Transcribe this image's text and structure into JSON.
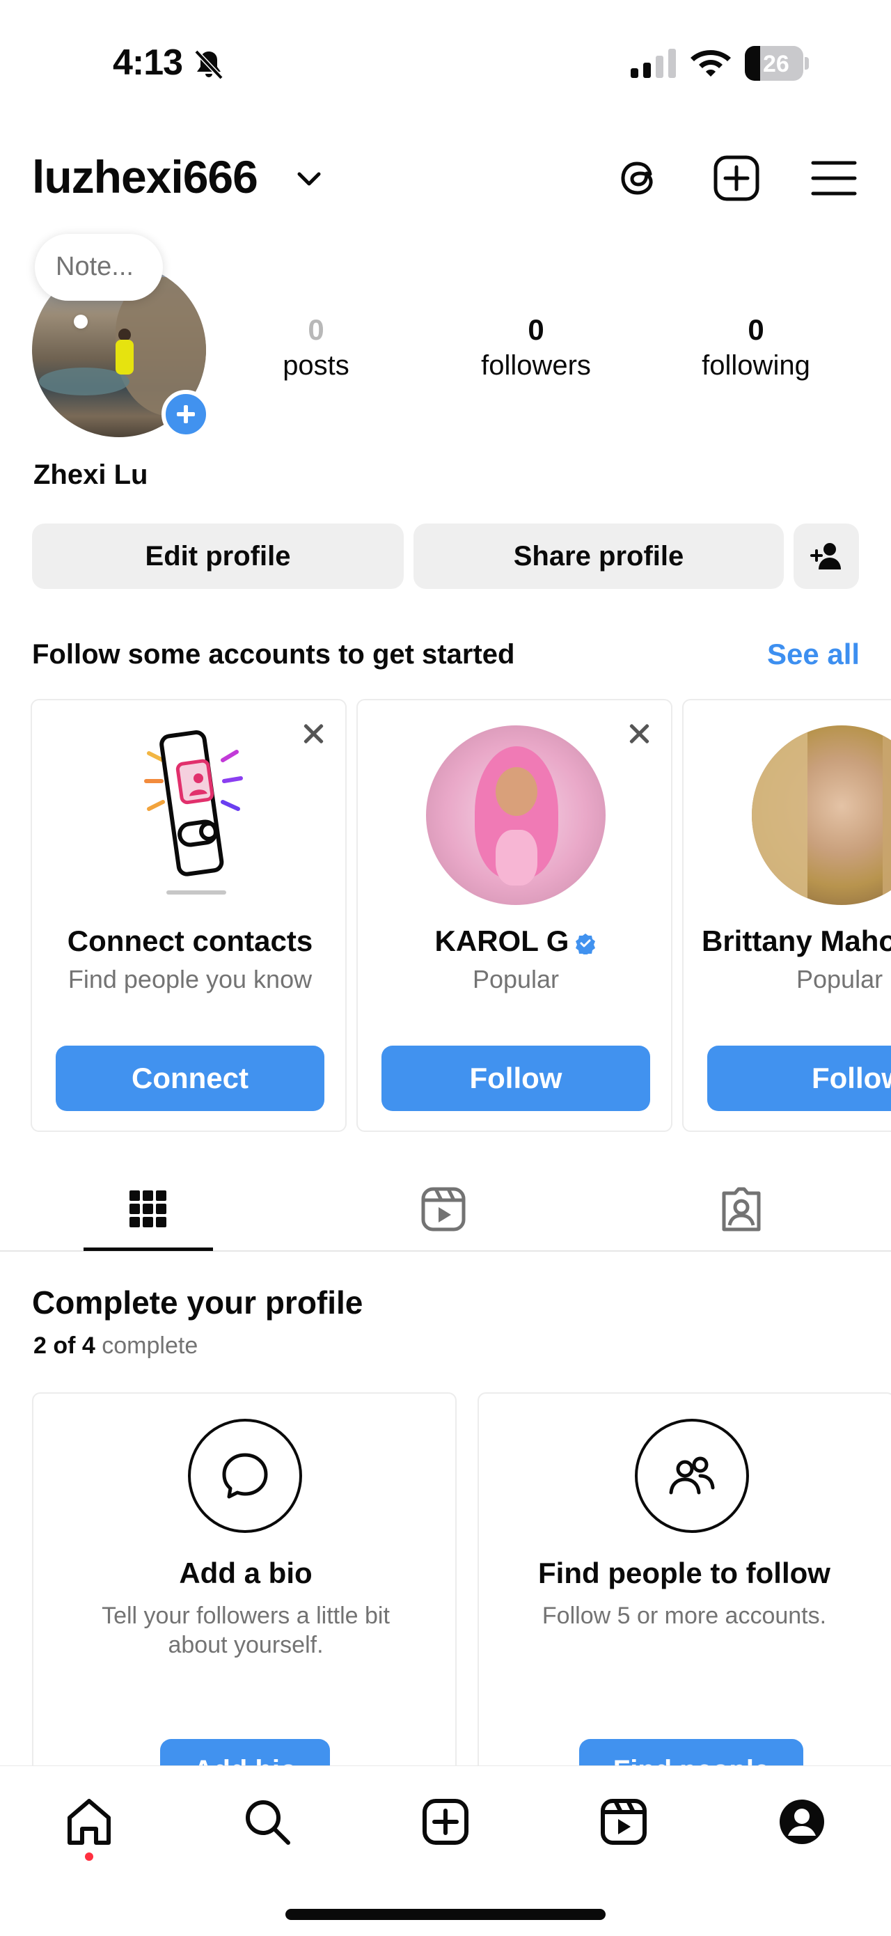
{
  "status_bar": {
    "time": "4:13",
    "battery_percent": "26",
    "battery_level": 0.26,
    "icons": [
      "bell-slash-icon",
      "cellular-signal-icon",
      "wifi-icon",
      "battery-icon"
    ]
  },
  "header": {
    "username": "luzhexi666",
    "icons": [
      "chevron-down-icon",
      "threads-icon",
      "create-plus-square-icon",
      "hamburger-menu-icon"
    ]
  },
  "profile": {
    "note_placeholder": "Note...",
    "full_name": "Zhexi Lu",
    "stats": {
      "posts": {
        "value": "0",
        "label": "posts"
      },
      "followers": {
        "value": "0",
        "label": "followers"
      },
      "following": {
        "value": "0",
        "label": "following"
      }
    },
    "buttons": {
      "edit": "Edit profile",
      "share": "Share profile"
    }
  },
  "suggestions": {
    "heading": "Follow some accounts to get started",
    "see_all": "See all",
    "cards": [
      {
        "title": "Connect contacts",
        "subtitle": "Find people you know",
        "button": "Connect"
      },
      {
        "title": "KAROL G",
        "subtitle": "Popular",
        "button": "Follow",
        "verified": true
      },
      {
        "title": "Brittany Maho",
        "subtitle": "Popular",
        "button": "Follow"
      }
    ]
  },
  "tabs": [
    "grid-icon",
    "reels-icon",
    "tagged-icon"
  ],
  "complete_profile": {
    "title": "Complete your profile",
    "progress_count": "2 of 4",
    "progress_word": "complete",
    "cards": [
      {
        "title": "Add a bio",
        "description": "Tell your followers a little bit about yourself.",
        "button": "Add bio"
      },
      {
        "title": "Find people to follow",
        "description": "Follow 5 or more accounts.",
        "button": "Find people"
      }
    ]
  },
  "bottom_nav": [
    "home-icon",
    "search-icon",
    "create-icon",
    "reels-icon",
    "profile-icon"
  ],
  "colors": {
    "accent_blue": "#4192ef",
    "link_blue": "#3d8ff0",
    "button_gray": "#efefef",
    "muted_text": "#737373",
    "notification_dot": "#ff3040"
  }
}
